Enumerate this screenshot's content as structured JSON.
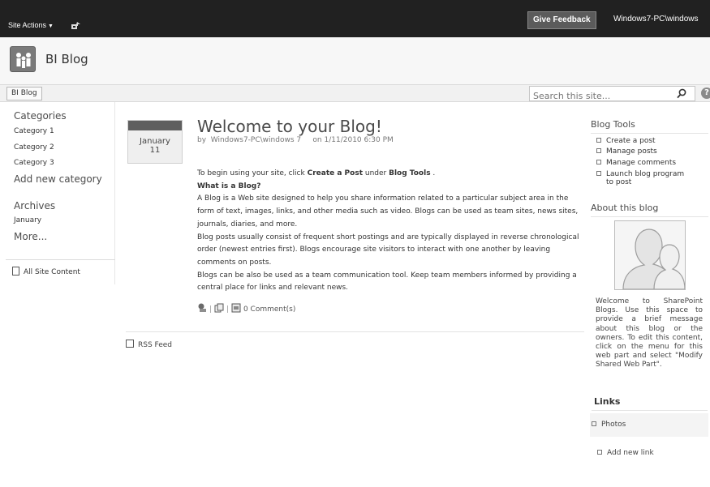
{
  "ribbon": {
    "site_actions": "Site Actions",
    "feedback": "Give Feedback",
    "user": "Windows7-PC\\windows"
  },
  "site": {
    "title": "BI Blog"
  },
  "topnav": {
    "tab": "BI Blog",
    "search_placeholder": "Search this site...",
    "help": "?"
  },
  "leftnav": {
    "categories_title": "Categories",
    "categories": [
      "Category 1",
      "Category 2",
      "Category 3"
    ],
    "add_category": "Add new category",
    "archives_title": "Archives",
    "archive_month": "January",
    "more": "More...",
    "all_site_content": "All Site Content"
  },
  "post": {
    "date_month": "January",
    "date_day": "11",
    "title": "Welcome to your Blog!",
    "by": "by",
    "author": "Windows7-PC\\windows 7",
    "on": "on 1/11/2010 6:30 PM",
    "intro_pre": "To begin using your site, click ",
    "intro_create": "Create a Post",
    "intro_mid": " under ",
    "intro_tools": "Blog Tools",
    "intro_post": " .",
    "heading": "What is a Blog?",
    "p1": "A Blog is a Web site designed to help you share information related to a particular subject area in the form of text, images, links, and other media such as video. Blogs can be used as team sites, news sites, journals, diaries, and more.",
    "p2": "Blog posts usually consist of frequent short postings and are typically displayed in reverse chronological order (newest entries first). Blogs encourage site visitors to interact with one another by leaving comments on posts.",
    "p3": "Blogs can be also be used as a team communication tool. Keep team members informed by providing a central place for links and relevant news.",
    "comments": "0 Comment(s)"
  },
  "rss": "RSS Feed",
  "blog_tools": {
    "title": "Blog Tools",
    "items": [
      "Create a post",
      "Manage posts",
      "Manage comments",
      "Launch blog program"
    ],
    "last_cont": "to post"
  },
  "about": {
    "title": "About this blog",
    "blurb": "Welcome to SharePoint Blogs. Use this space to provide a brief message about this blog or the owners. To edit this content, click on the menu for this web part and select \"Modify Shared Web Part\"."
  },
  "links": {
    "title": "Links",
    "photos": "Photos",
    "add_new": "Add new link"
  }
}
